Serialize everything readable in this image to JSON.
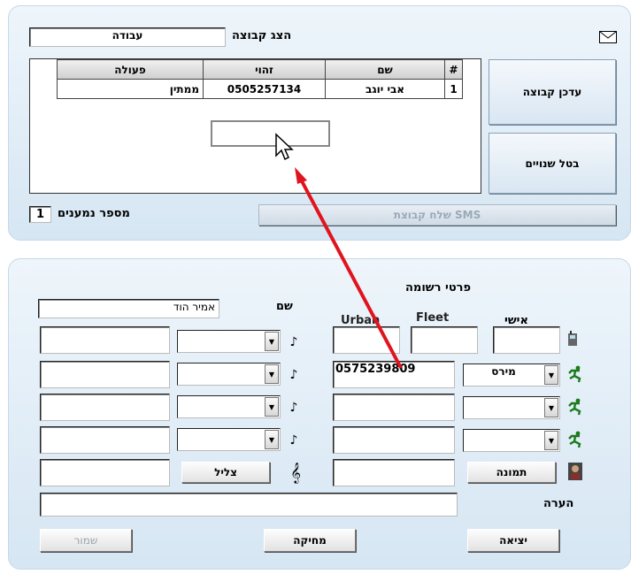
{
  "group_display": {
    "label": "הצג קבוצה",
    "value": "עבודה"
  },
  "group_table": {
    "headers": [
      "#",
      "שם",
      "זהוי",
      "פעולה"
    ],
    "rows": [
      {
        "num": "1",
        "name": "אבי יוגב",
        "id": "0505257134",
        "action": "ממתין"
      }
    ]
  },
  "buttons": {
    "update_group": "עדכן קבוצה",
    "cancel_changes": "בטל שנויים",
    "send_sms": "SMS שלח קבוצת",
    "photo": "צליל",
    "image": "תמונה",
    "exit": "יציאה",
    "delete": "מחיקה",
    "save": "שמור"
  },
  "recipients": {
    "label": "מספר נמענים",
    "count": "1"
  },
  "record": {
    "title": "פרטי רשומה",
    "name_label": "שם",
    "name_value": "אמיר הוד",
    "col_personal": "אישי",
    "col_fleet": "Fleet",
    "col_urban": "Urban",
    "mirs_select": "מירס",
    "phone_value": "0575239809",
    "note_label": "הערה"
  },
  "colors": {
    "arrow": "#e0141e",
    "panel": "#dbe8f4"
  },
  "icons": [
    "envelope-icon",
    "mouse-cursor-icon",
    "phone-icon",
    "person-running-icon",
    "ringtone-icon",
    "music-clef-icon",
    "photo-icon"
  ]
}
